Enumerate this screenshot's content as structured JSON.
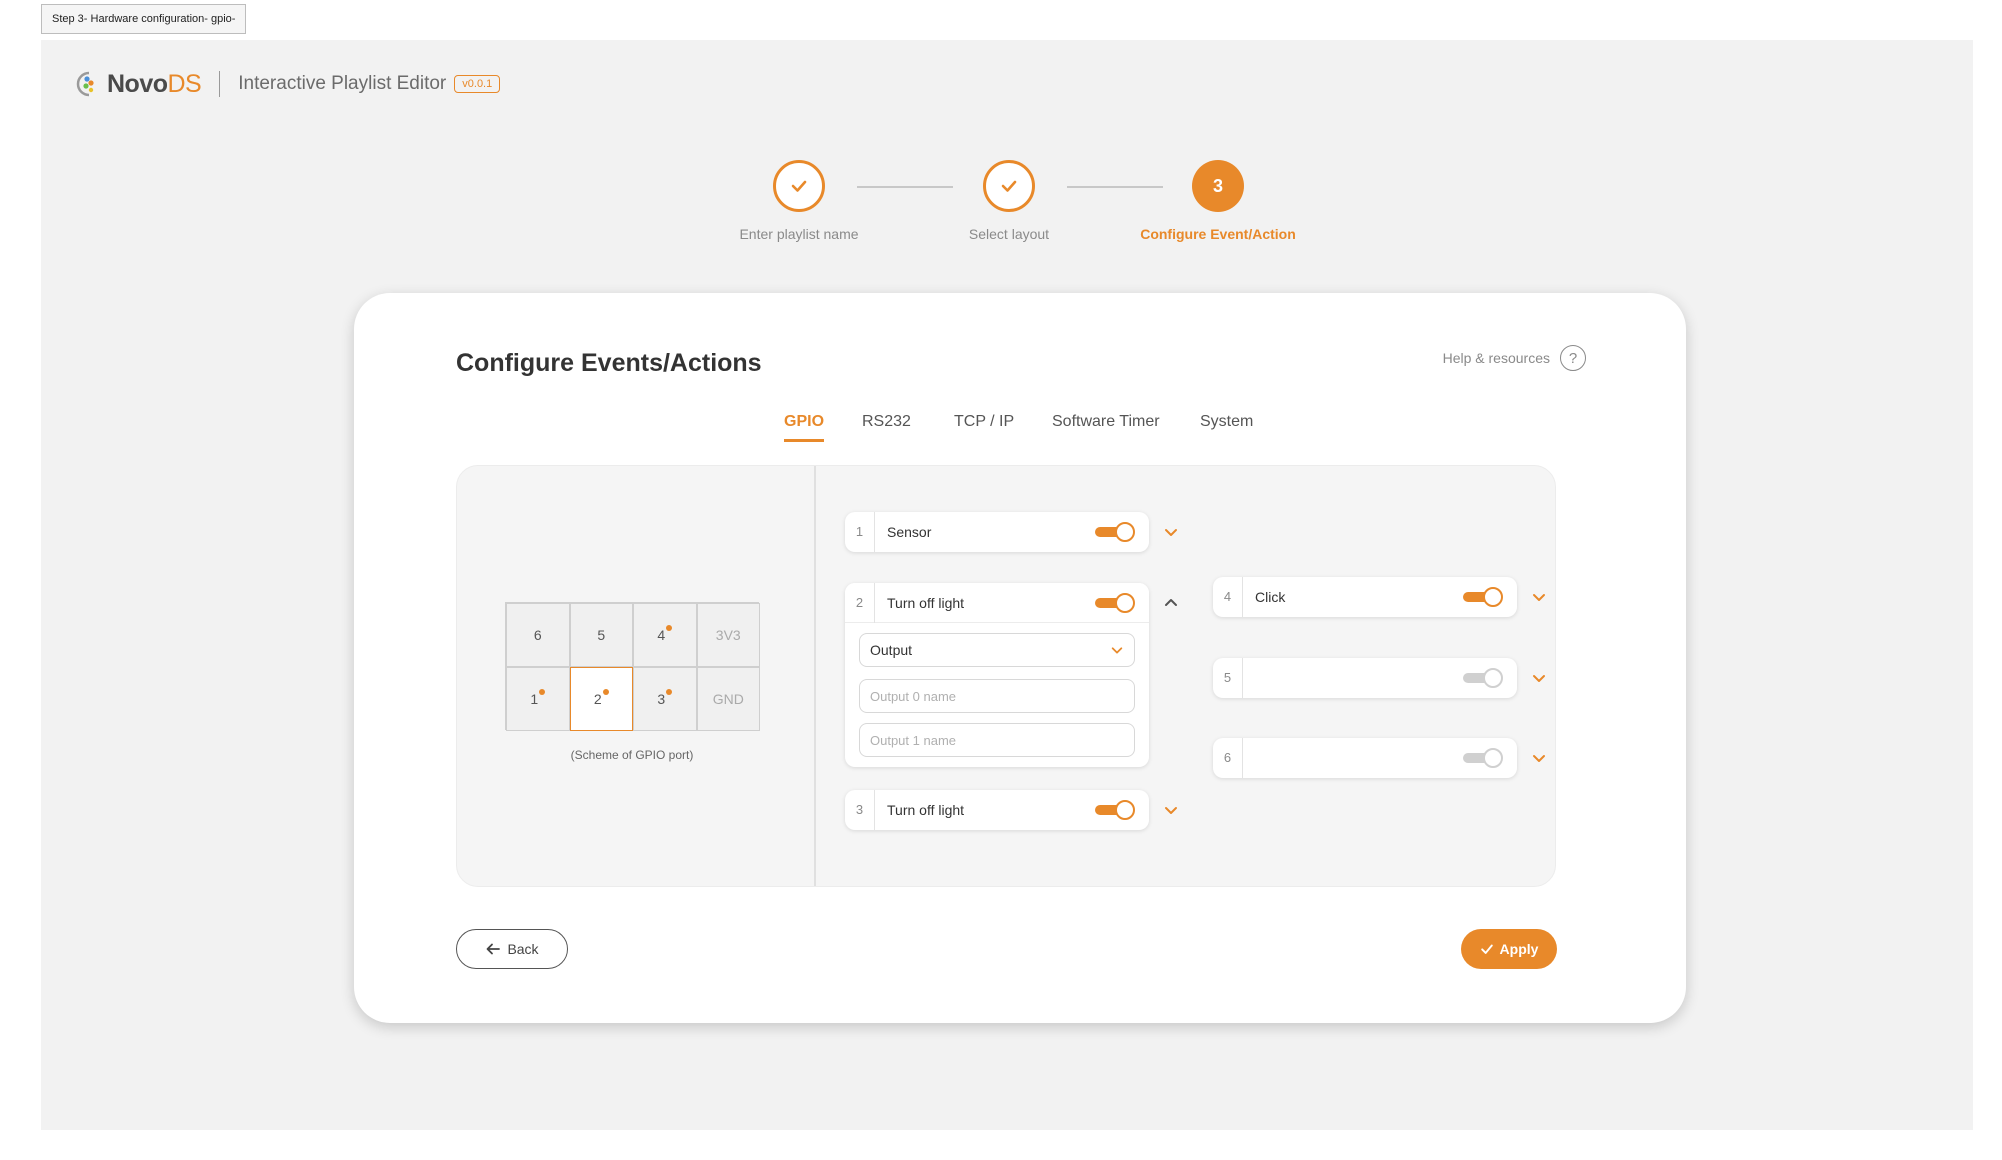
{
  "frame_label": "Step 3- Hardware configuration- gpio-",
  "brand": {
    "name_a": "Novo",
    "name_b": "DS",
    "app_title": "Interactive Playlist Editor",
    "version": "v0.0.1"
  },
  "stepper": {
    "steps": [
      {
        "label": "Enter playlist name",
        "state": "done"
      },
      {
        "label": "Select layout",
        "state": "done"
      },
      {
        "label": "Configure Event/Action",
        "state": "active",
        "number": "3"
      }
    ]
  },
  "card": {
    "title": "Configure Events/Actions",
    "help_label": "Help & resources",
    "help_icon": "?"
  },
  "tabs": [
    "GPIO",
    "RS232",
    "TCP / IP",
    "Software Timer",
    "System"
  ],
  "active_tab": "GPIO",
  "scheme": {
    "top_row": [
      "6",
      "5",
      "4",
      "3V3"
    ],
    "bottom_row": [
      "1",
      "2",
      "3",
      "GND"
    ],
    "caption": "(Scheme of GPIO port)",
    "selected_pin": "2"
  },
  "gpio": [
    {
      "num": "1",
      "name": "Sensor",
      "enabled": true
    },
    {
      "num": "2",
      "name": "Turn off light",
      "enabled": true,
      "expanded": true,
      "mode": "Output",
      "output0_placeholder": "Output 0 name",
      "output1_placeholder": "Output 1 name"
    },
    {
      "num": "3",
      "name": "Turn off light",
      "enabled": true
    },
    {
      "num": "4",
      "name": "Click",
      "enabled": true
    },
    {
      "num": "5",
      "name": "",
      "enabled": false
    },
    {
      "num": "6",
      "name": "",
      "enabled": false
    }
  ],
  "buttons": {
    "back": "Back",
    "apply": "Apply"
  },
  "colors": {
    "accent": "#e8892a",
    "background": "#f2f2f2",
    "card": "#ffffff"
  }
}
